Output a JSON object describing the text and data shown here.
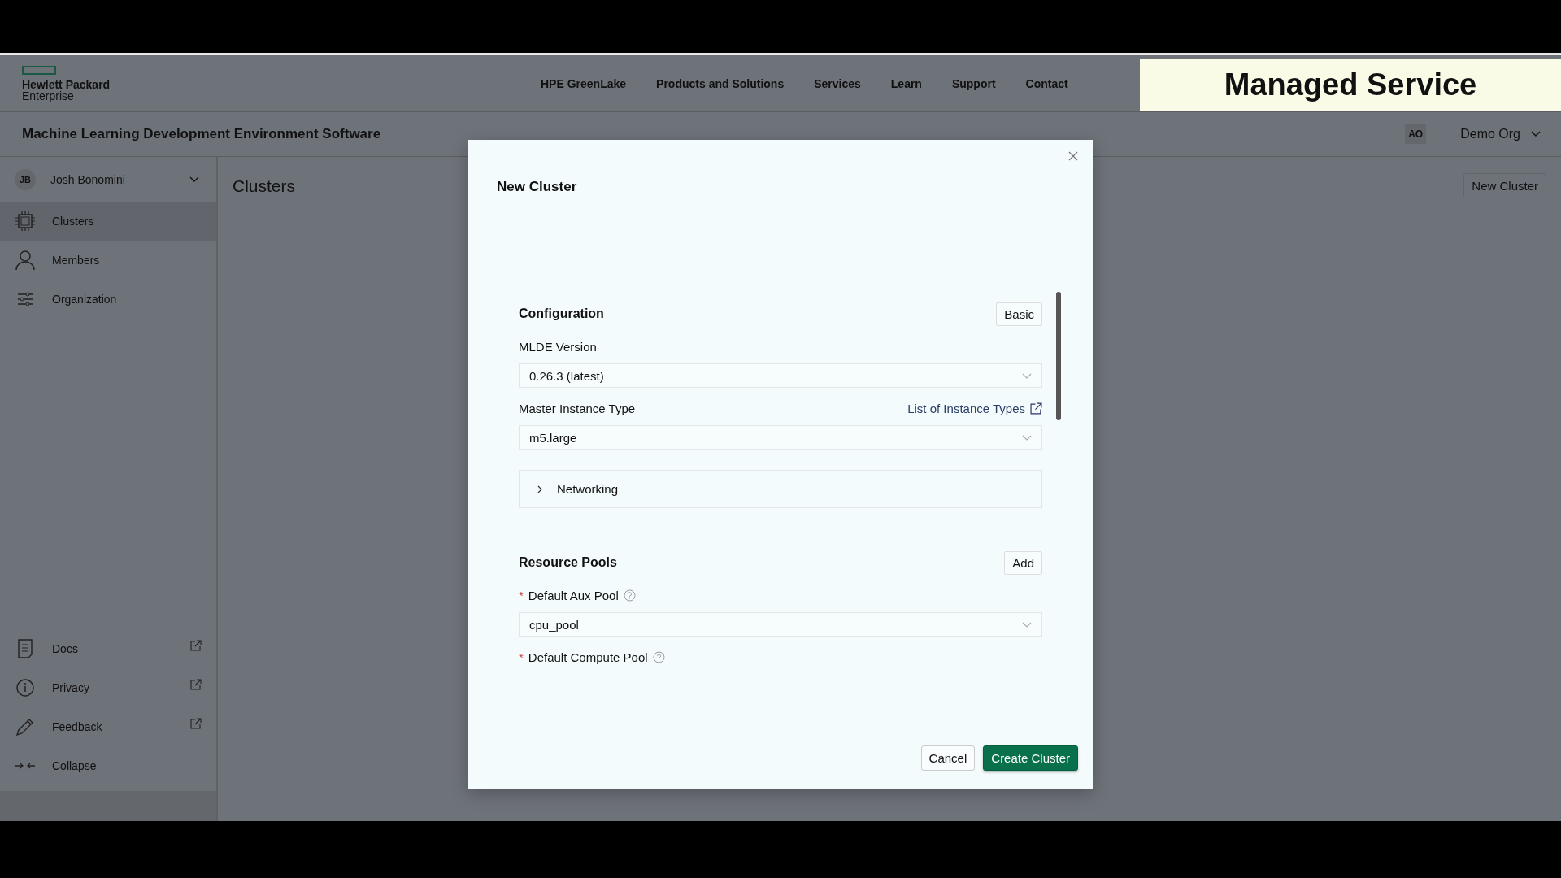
{
  "site_header": {
    "logo_lines": [
      "Hewlett Packard",
      "Enterprise"
    ],
    "nav": [
      "HPE GreenLake",
      "Products and Solutions",
      "Services",
      "Learn",
      "Support",
      "Contact"
    ],
    "banner": "Managed Service"
  },
  "app_bar": {
    "title": "Machine Learning Development Environment Software",
    "org_initials": "AO",
    "org_name": "Demo Org"
  },
  "sidebar": {
    "user": {
      "initials": "JB",
      "name": "Josh Bonomini"
    },
    "items": [
      {
        "label": "Clusters",
        "selected": true
      },
      {
        "label": "Members",
        "selected": false
      },
      {
        "label": "Organization",
        "selected": false
      }
    ],
    "footer_items": [
      {
        "label": "Docs",
        "external": true
      },
      {
        "label": "Privacy",
        "external": true
      },
      {
        "label": "Feedback",
        "external": true
      },
      {
        "label": "Collapse",
        "external": false
      }
    ]
  },
  "main": {
    "title": "Clusters",
    "new_button": "New Cluster"
  },
  "dialog": {
    "title": "New Cluster",
    "configuration": {
      "title": "Configuration",
      "mode_button": "Basic",
      "fields": [
        {
          "label": "MLDE Version",
          "value": "0.26.3 (latest)"
        },
        {
          "label": "Master Instance Type",
          "link": "List of Instance Types",
          "value": "m5.large"
        }
      ],
      "networking": {
        "label": "Networking",
        "expanded": false
      }
    },
    "resource_pools": {
      "title": "Resource Pools",
      "add_button": "Add",
      "fields": [
        {
          "label": "Default Aux Pool",
          "required_mark": "*",
          "value": "cpu_pool"
        },
        {
          "label": "Default Compute Pool",
          "required_mark": "*"
        }
      ]
    },
    "buttons": [
      {
        "label": "Cancel",
        "kind": "secondary"
      },
      {
        "label": "Create Cluster",
        "kind": "primary"
      }
    ]
  }
}
